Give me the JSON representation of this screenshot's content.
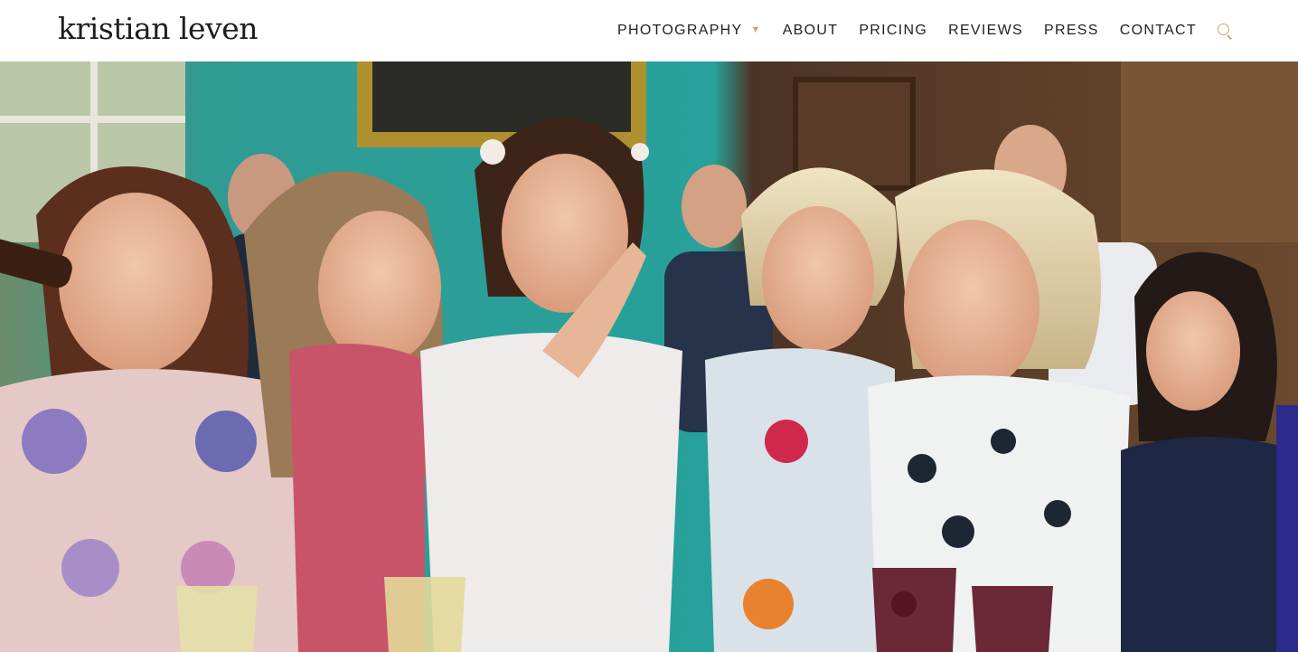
{
  "brand": {
    "name": "kristian leven"
  },
  "nav": {
    "items": [
      {
        "label": "PHOTOGRAPHY",
        "has_dropdown": true
      },
      {
        "label": "ABOUT"
      },
      {
        "label": "PRICING"
      },
      {
        "label": "REVIEWS"
      },
      {
        "label": "PRESS"
      },
      {
        "label": "CONTACT"
      }
    ],
    "search_icon": "search-icon"
  },
  "hero": {
    "image": "wedding-guests-laughing-photo"
  },
  "colors": {
    "accent": "#c9a968",
    "text": "#222222",
    "background": "#ffffff"
  }
}
